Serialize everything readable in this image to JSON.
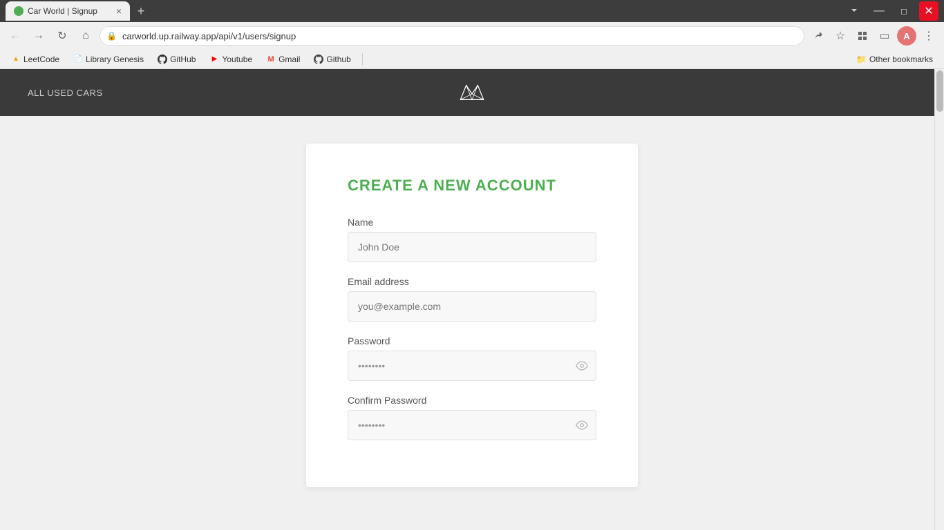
{
  "browser": {
    "tab": {
      "favicon_color": "#4caf50",
      "title": "Car World | Signup",
      "close_label": "×"
    },
    "new_tab_label": "+",
    "window_controls": {
      "minimize": "—",
      "maximize": "❐",
      "close": "✕"
    },
    "address_bar": {
      "back_disabled": false,
      "forward_disabled": false,
      "url": "carworld.up.railway.app/api/v1/users/signup",
      "lock_icon": "🔒"
    },
    "toolbar": {
      "share_icon": "↗",
      "star_icon": "☆",
      "extensions_icon": "⚡",
      "sidebar_icon": "▣",
      "profile_label": "A",
      "menu_icon": "⋮",
      "dropdown_icon": "▾"
    },
    "bookmarks": [
      {
        "id": "leetcode",
        "favicon": "🟡",
        "label": "LeetCode"
      },
      {
        "id": "library-genesis",
        "favicon": "📄",
        "label": "Library Genesis"
      },
      {
        "id": "github",
        "favicon": "⚫",
        "label": "GitHub"
      },
      {
        "id": "youtube",
        "favicon": "▶",
        "label": "Youtube",
        "favicon_color": "red"
      },
      {
        "id": "gmail",
        "favicon": "M",
        "label": "Gmail"
      },
      {
        "id": "github2",
        "favicon": "⚫",
        "label": "Github"
      }
    ],
    "other_bookmarks_label": "Other bookmarks",
    "other_bookmarks_icon": "📁"
  },
  "app": {
    "header": {
      "nav_link_label": "ALL USED CARS",
      "logo_alt": "Car World Crown Logo"
    },
    "form": {
      "title": "CREATE A NEW ACCOUNT",
      "fields": {
        "name": {
          "label": "Name",
          "placeholder": "John Doe",
          "value": ""
        },
        "email": {
          "label": "Email address",
          "placeholder": "you@example.com",
          "value": ""
        },
        "password": {
          "label": "Password",
          "placeholder": "••••••••",
          "value": "••••••••"
        },
        "confirm_password": {
          "label": "Confirm Password",
          "placeholder": "••••••••",
          "value": "••••••••"
        }
      },
      "eye_icon": "👁",
      "toggle_password_label": "show/hide password"
    }
  }
}
